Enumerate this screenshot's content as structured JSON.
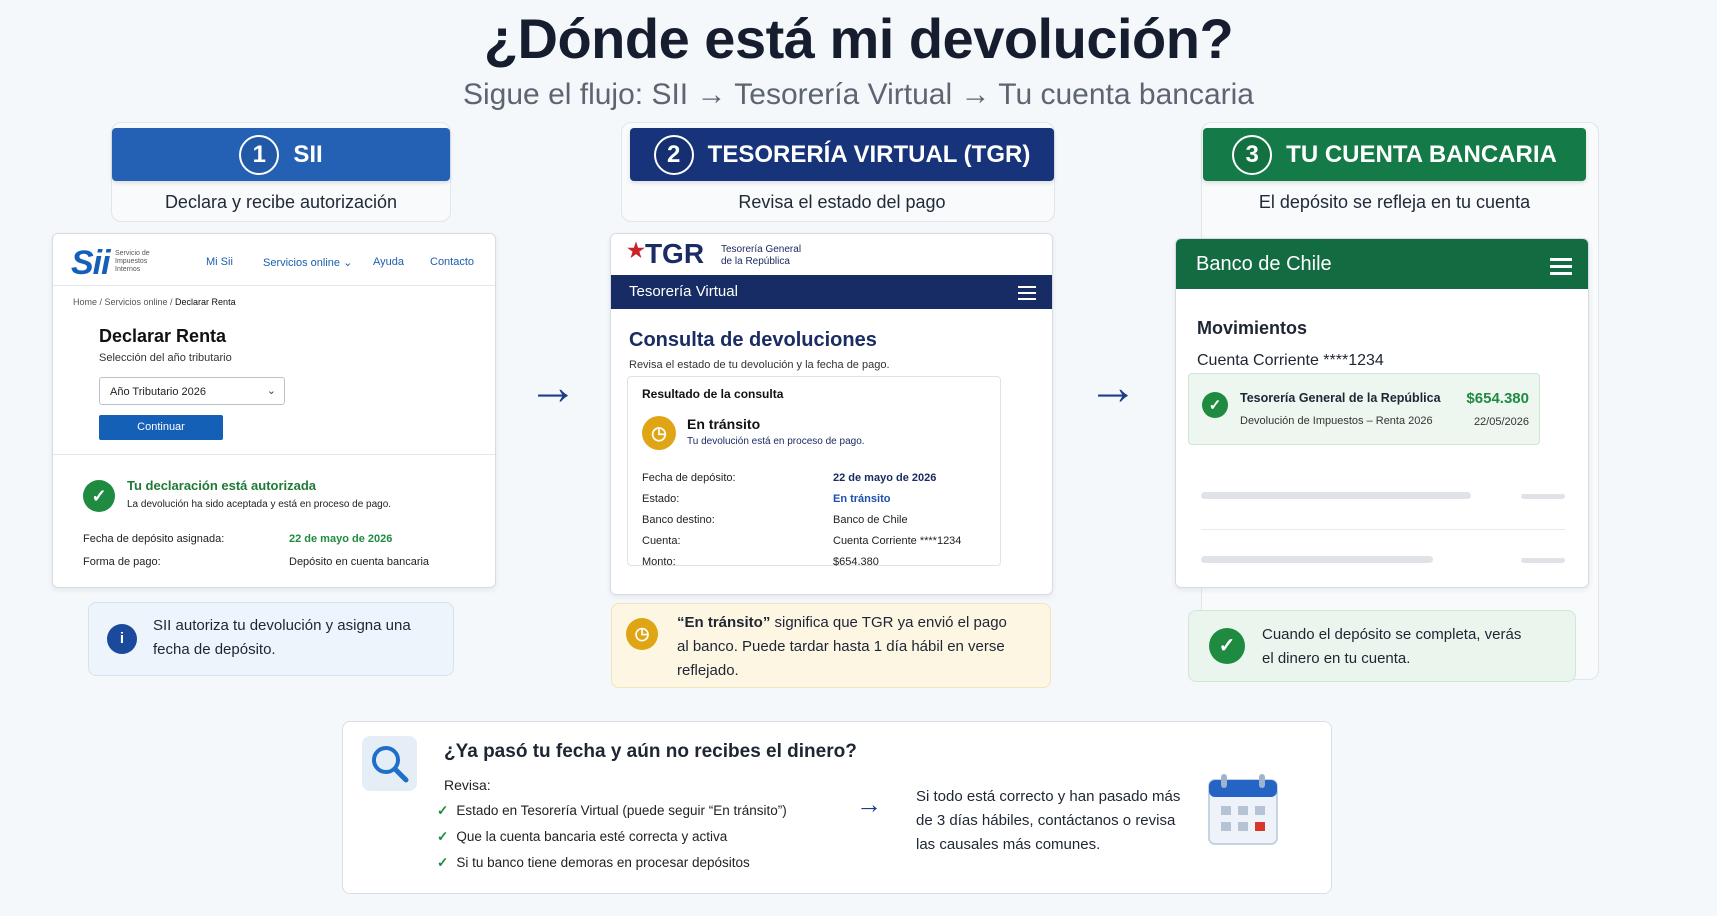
{
  "title": "¿Dónde está mi devolución?",
  "subtitle": "Sigue el flujo: SII → Tesorería Virtual → Tu cuenta bancaria",
  "steps": [
    {
      "num": "1",
      "label": "SII",
      "desc": "Declara y recibe autorización",
      "color": "#2461b5"
    },
    {
      "num": "2",
      "label": "TESORERÍA VIRTUAL (TGR)",
      "desc": "Revisa el estado del pago",
      "color": "#17337a"
    },
    {
      "num": "3",
      "label": "TU CUENTA BANCARIA",
      "desc": "El depósito se refleja en tu cuenta",
      "color": "#147a47"
    }
  ],
  "sii": {
    "logo": "Sii",
    "logo_sub": "Servicio de Impuestos Internos",
    "nav": [
      "Mi Sii",
      "Servicios online ⌄",
      "Ayuda",
      "Contacto"
    ],
    "breadcrumb_home": "Home / Servicios online / ",
    "breadcrumb_current": "Declarar Renta",
    "heading": "Declarar Renta",
    "subheading": "Selección del año tributario",
    "select_value": "Año Tributario 2026",
    "button": "Continuar",
    "status_title": "Tu declaración está autorizada",
    "status_text": "La devolución ha sido aceptada y está en proceso de pago.",
    "rows": [
      {
        "label": "Fecha de depósito asignada:",
        "value": "22 de mayo de 2026"
      },
      {
        "label": "Forma de pago:",
        "value": "Depósito en cuenta bancaria"
      }
    ],
    "info": "SII autoriza tu devolución y asigna una fecha de depósito."
  },
  "tgr": {
    "logo": "TGR",
    "logo_sub_1": "Tesorería General",
    "logo_sub_2": "de la República",
    "bar_title": "Tesorería Virtual",
    "heading": "Consulta de devoluciones",
    "subheading": "Revisa el estado de tu devolución y la fecha de pago.",
    "result_title": "Resultado de la consulta",
    "status": "En tránsito",
    "status_text": "Tu devolución está en proceso de pago.",
    "rows": [
      {
        "label": "Fecha de depósito:",
        "value": "22 de mayo de 2026"
      },
      {
        "label": "Estado:",
        "value": "En tránsito"
      },
      {
        "label": "Banco destino:",
        "value": "Banco de Chile"
      },
      {
        "label": "Cuenta:",
        "value": "Cuenta Corriente ****1234"
      },
      {
        "label": "Monto:",
        "value": "$654.380"
      }
    ],
    "info_bold": "“En tránsito”",
    "info_rest": " significa que TGR ya envió el pago al banco. Puede tardar hasta 1 día hábil en verse reflejado."
  },
  "bank": {
    "name": "Banco de Chile",
    "section": "Movimientos",
    "account": "Cuenta Corriente ****1234",
    "tx_title": "Tesorería General de la República",
    "tx_desc": "Devolución de Impuestos – Renta 2026",
    "tx_amount": "$654.380",
    "tx_date": "22/05/2026",
    "info": "Cuando el depósito se completa, verás el dinero en tu cuenta."
  },
  "help": {
    "question": "¿Ya pasó tu fecha y aún no recibes el dinero?",
    "check_label": "Revisa:",
    "checks": [
      "Estado en Tesorería Virtual (puede seguir “En tránsito”)",
      "Que la cuenta bancaria esté correcta y activa",
      "Si tu banco tiene demoras en procesar depósitos"
    ],
    "advice": "Si todo está correcto y han pasado más de 3 días hábiles, contáctanos o revisa las causales más comunes."
  }
}
